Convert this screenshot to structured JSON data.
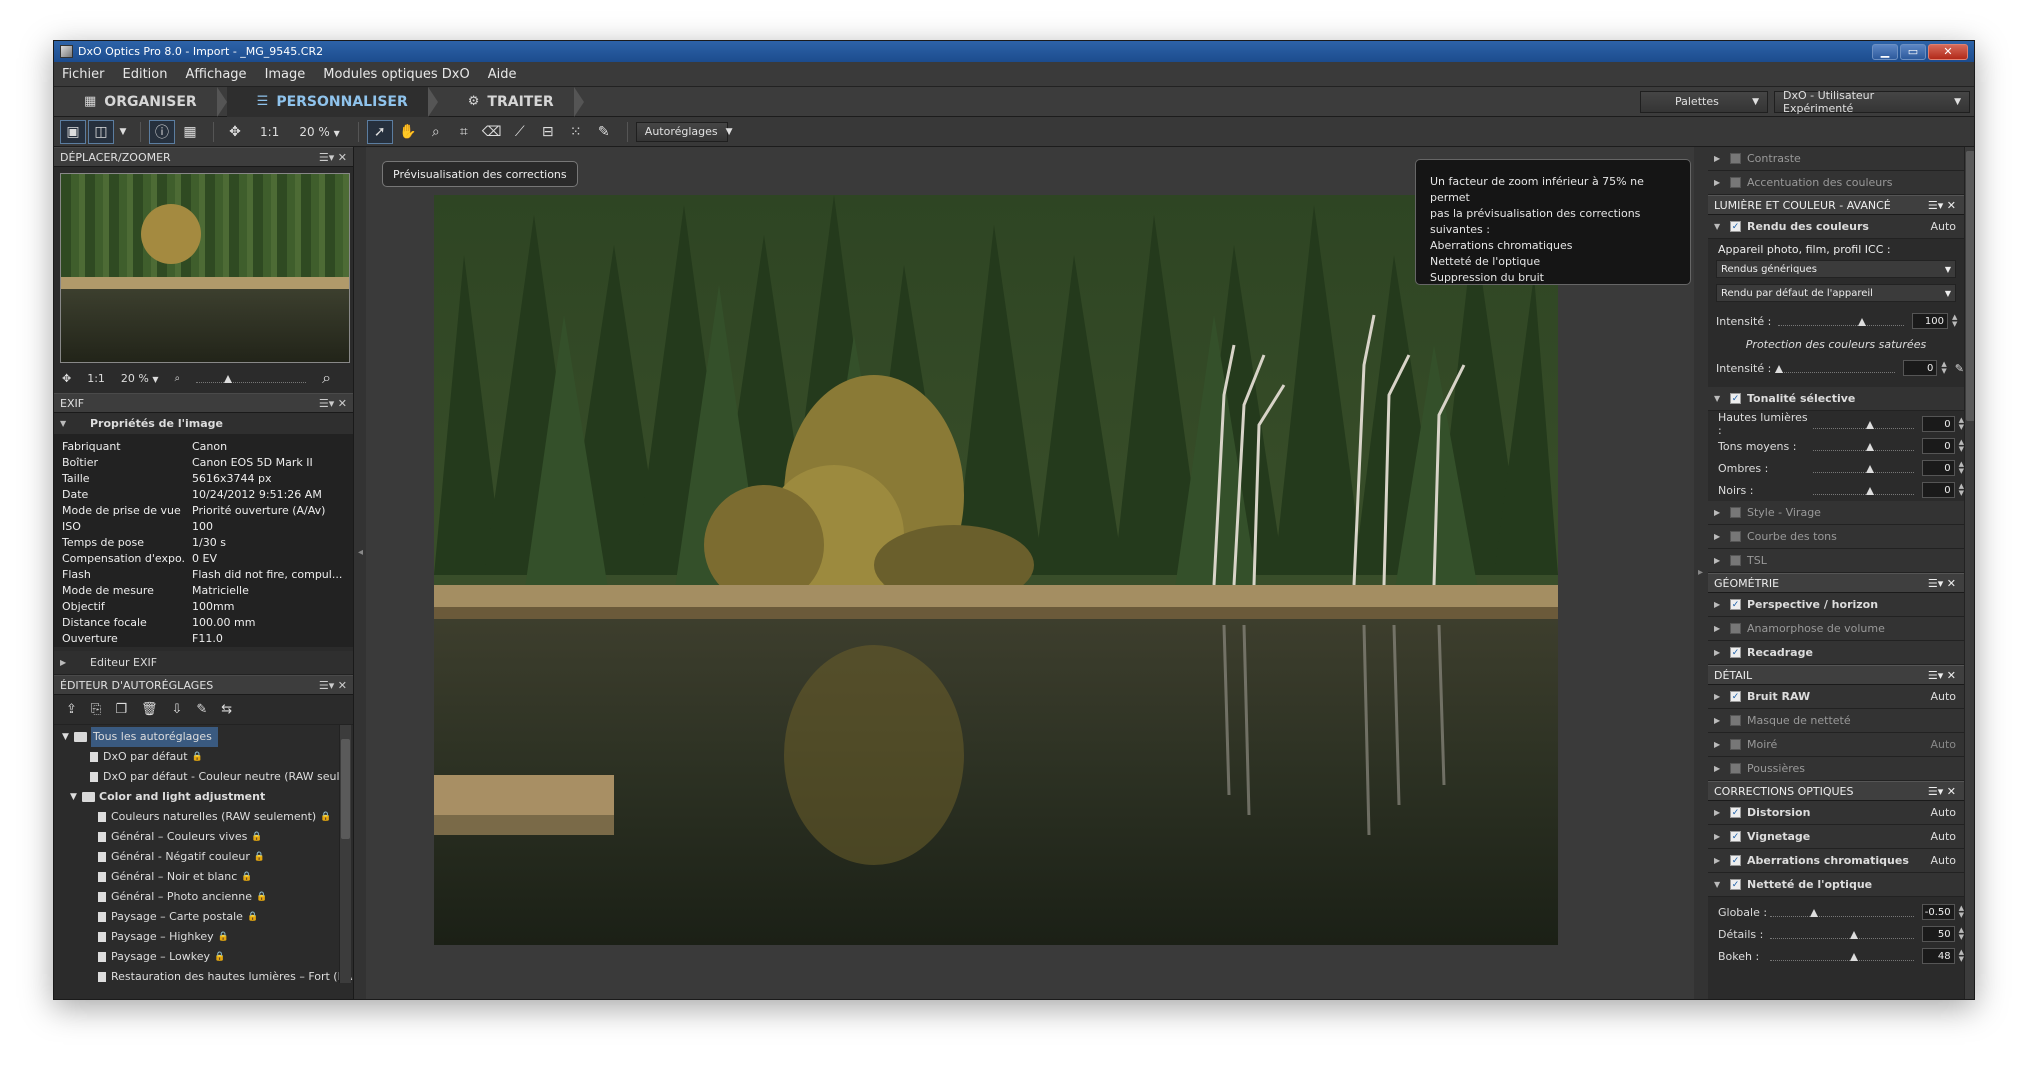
{
  "window": {
    "title": "DxO Optics Pro 8.0 - Import - _MG_9545.CR2",
    "controls": [
      "▁",
      "▭",
      "✕"
    ]
  },
  "menu": [
    "Fichier",
    "Edition",
    "Affichage",
    "Image",
    "Modules optiques DxO",
    "Aide"
  ],
  "modes": [
    {
      "label": "ORGANISER",
      "icon": "grid-icon",
      "active": false
    },
    {
      "label": "PERSONNALISER",
      "icon": "sliders-icon",
      "active": true
    },
    {
      "label": "TRAITER",
      "icon": "gears-icon",
      "active": false
    }
  ],
  "palettes_dropdown": "Palettes",
  "workspace_dropdown": "DxO - Utilisateur Expérimenté",
  "toolbar": {
    "one_to_one": "1:1",
    "zoom": "20 %",
    "presets": "Autoréglages"
  },
  "navigator": {
    "title": "DÉPLACER/ZOOMER",
    "one_to_one": "1:1",
    "zoom": "20 %"
  },
  "exif": {
    "title": "EXIF",
    "section": "Propriétés de l'image",
    "rows": [
      [
        "Fabriquant",
        "Canon"
      ],
      [
        "Boîtier",
        "Canon EOS 5D Mark II"
      ],
      [
        "Taille",
        "5616x3744 px"
      ],
      [
        "Date",
        "10/24/2012 9:51:26 AM"
      ],
      [
        "Mode de prise de vue",
        "Priorité ouverture (A/Av)"
      ],
      [
        "ISO",
        "100"
      ],
      [
        "Temps de pose",
        "1/30 s"
      ],
      [
        "Compensation d'expo.",
        "0 EV"
      ],
      [
        "Flash",
        "Flash did not fire, compul..."
      ],
      [
        "Mode de mesure",
        "Matricielle"
      ],
      [
        "Objectif",
        "100mm"
      ],
      [
        "Distance focale",
        "100.00 mm"
      ],
      [
        "Ouverture",
        "F11.0"
      ]
    ],
    "editor": "Editeur EXIF"
  },
  "presets": {
    "title": "ÉDITEUR D'AUTORÉGLAGES",
    "root": "Tous les autoréglages",
    "items": [
      {
        "label": "DxO par défaut",
        "indent": 1,
        "lock": true
      },
      {
        "label": "DxO par défaut - Couleur neutre (RAW seule",
        "indent": 1,
        "lock": false
      }
    ],
    "group": "Color and light adjustment",
    "group_items": [
      "Couleurs naturelles (RAW seulement)",
      "Général – Couleurs vives",
      "Général - Négatif couleur",
      "Général – Noir et blanc",
      "Général – Photo ancienne",
      "Paysage – Carte postale",
      "Paysage – Highkey",
      "Paysage – Lowkey",
      "Restauration des hautes lumières – Fort (RA"
    ]
  },
  "viewer": {
    "preview_label": "Prévisualisation des corrections",
    "info_lines": [
      "Un facteur de zoom inférieur à 75% ne permet",
      "pas la prévisualisation des corrections",
      "suivantes :",
      "Aberrations chromatiques",
      "Netteté de l'optique",
      "Suppression du bruit"
    ]
  },
  "right": {
    "top_items": [
      "Contraste",
      "Accentuation des couleurs"
    ],
    "lumiere_title": "LUMIÈRE ET COULEUR - AVANCÉ",
    "rendu": {
      "label": "Rendu des couleurs",
      "auto": "Auto",
      "camera_label": "Appareil photo, film, profil ICC :",
      "sel1": "Rendus génériques",
      "sel2": "Rendu par défaut de l'appareil",
      "intensite_label": "Intensité :",
      "intensite": "100",
      "protection": "Protection des couleurs saturées",
      "intensite2": "0"
    },
    "tonalite": {
      "label": "Tonalité sélective",
      "rows": [
        [
          "Hautes lumières :",
          "0"
        ],
        [
          "Tons moyens :",
          "0"
        ],
        [
          "Ombres :",
          "0"
        ],
        [
          "Noirs :",
          "0"
        ]
      ]
    },
    "lumiere_more": [
      "Style - Virage",
      "Courbe des tons",
      "TSL"
    ],
    "geo_title": "GÉOMÉTRIE",
    "geo_items": [
      "Perspective / horizon",
      "Anamorphose de volume",
      "Recadrage"
    ],
    "detail_title": "DÉTAIL",
    "detail_items": [
      {
        "label": "Bruit RAW",
        "auto": "Auto"
      },
      {
        "label": "Masque de netteté",
        "auto": ""
      },
      {
        "label": "Moiré",
        "auto": "Auto"
      },
      {
        "label": "Poussières",
        "auto": ""
      }
    ],
    "optic_title": "CORRECTIONS OPTIQUES",
    "optic_items": [
      {
        "label": "Distorsion",
        "auto": "Auto"
      },
      {
        "label": "Vignetage",
        "auto": "Auto"
      },
      {
        "label": "Aberrations chromatiques",
        "auto": "Auto"
      }
    ],
    "nettete": {
      "label": "Netteté de l'optique",
      "rows": [
        [
          "Globale :",
          "-0.50"
        ],
        [
          "Détails :",
          "50"
        ],
        [
          "Bokeh :",
          "48"
        ]
      ]
    }
  },
  "colors": {
    "accent": "#8fc3ec",
    "titlebar": "#2d63a8",
    "panel": "#2b2b2b"
  }
}
